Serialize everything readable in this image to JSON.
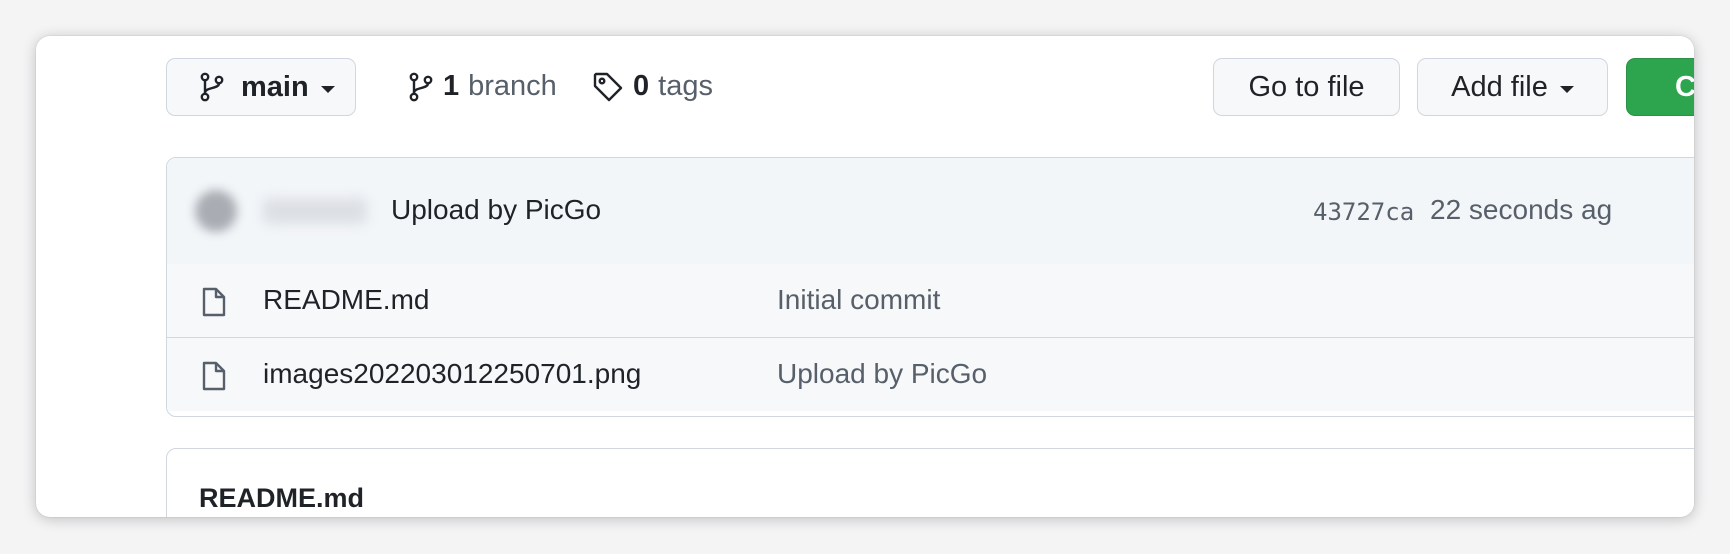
{
  "toolbar": {
    "branch_selector": "main",
    "branches_count": "1",
    "branches_label": "branch",
    "tags_count": "0",
    "tags_label": "tags",
    "go_to_file": "Go to file",
    "add_file": "Add file",
    "code_button": "Co"
  },
  "latest_commit": {
    "author": "",
    "message": "Upload by PicGo",
    "sha": "43727ca",
    "time": "22 seconds ag"
  },
  "files": [
    {
      "name": "README.md",
      "commit_message": "Initial commit",
      "icon": "file-icon"
    },
    {
      "name": "images202203012250701.png",
      "commit_message": "Upload by PicGo",
      "icon": "file-icon"
    }
  ],
  "readme": {
    "title": "README.md"
  },
  "colors": {
    "accent_green": "#2da44e",
    "border": "#d0d7de",
    "muted": "#57606a"
  }
}
